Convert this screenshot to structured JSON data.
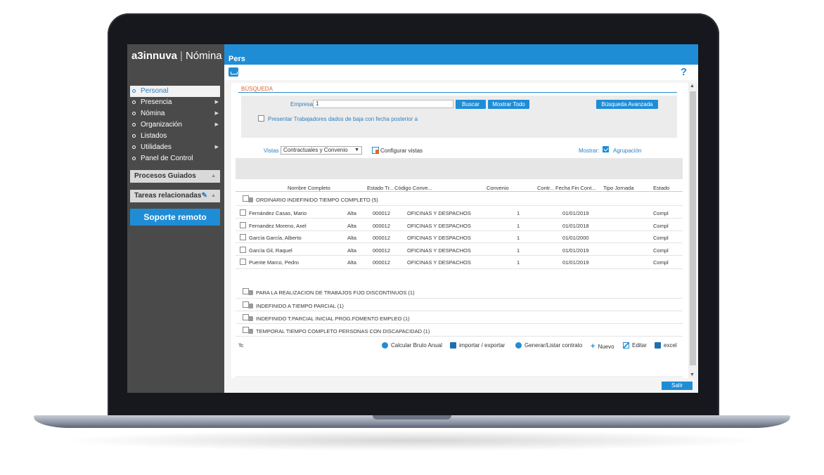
{
  "app": {
    "brand_bold": "a3innuva",
    "brand_separator": "|",
    "brand_product": "Nómina",
    "window_title": "Pers"
  },
  "sidebar": {
    "items": [
      {
        "label": "Personal",
        "active": true,
        "has_submenu": false
      },
      {
        "label": "Presencia",
        "has_submenu": true
      },
      {
        "label": "Nómina",
        "has_submenu": true
      },
      {
        "label": "Organización",
        "has_submenu": true
      },
      {
        "label": "Listados",
        "has_submenu": false
      },
      {
        "label": "Utilidades",
        "has_submenu": true
      },
      {
        "label": "Panel de Control",
        "has_submenu": false
      }
    ],
    "procesos_label": "Procesos Guiados",
    "tareas_label": "Tareas relacionadas",
    "remote_button": "Soporte remoto"
  },
  "search": {
    "section_label": "BÚSQUEDA",
    "empresa_label": "Empresa",
    "empresa_value": "1",
    "buscar_button": "Buscar",
    "mostrar_todo_button": "Mostrar Todo",
    "advanced_button": "Búsqueda Avanzada",
    "baja_checkbox_label": "Presentar Trabajadores dados de baja con fecha posterior a"
  },
  "views": {
    "label": "Vistas",
    "selected": "Contractuales y Convenio",
    "configure": "Configurar vistas",
    "mostrar_label": "Mostrar:",
    "agrupacion_label": "Agrupación"
  },
  "table": {
    "headers": [
      "Nombre Completo",
      "Estado Tr...",
      "Código Conve...",
      "Convenio",
      "Contr...",
      "Fecha Fin Cont...",
      "Tipo Jornada",
      "Estado"
    ],
    "expanded_group": "ORDINARIO INDEFINIDO TIEMPO COMPLETO (5)",
    "rows": [
      [
        "Fernández Casas, Mario",
        "Alta",
        "000012",
        "OFICINAS Y DESPACHOS",
        "1",
        "01/01/2019",
        "Compl"
      ],
      [
        "Fernandez Moreno, Axel",
        "Alta",
        "000012",
        "OFICINAS Y DESPACHOS",
        "1",
        "01/01/2018",
        "Compl"
      ],
      [
        "García García, Alberto",
        "Alta",
        "000012",
        "OFICINAS Y DESPACHOS",
        "1",
        "01/01/2000",
        "Compl"
      ],
      [
        "García Gil, Raquel",
        "Alta",
        "000012",
        "OFICINAS Y DESPACHOS",
        "1",
        "01/01/2019",
        "Compl"
      ],
      [
        "Puente Marco, Pedro",
        "Alta",
        "000012",
        "OFICINAS Y DESPACHOS",
        "1",
        "01/01/2019",
        "Compl"
      ]
    ],
    "collapsed_groups": [
      "PARA LA REALIZACION DE TRABAJOS FIJO DISCONTINUOS (1)",
      "INDEFINIDO A TIEMPO PARCIAL (1)",
      "INDEFINIDO T.PARCIAL INICIAL PROG.FOMENTO EMPLEO (1)",
      "TEMPORAL TIEMPO COMPLETO PERSONAS CON DISCAPACIDAD (1)"
    ],
    "footer_truncated": "Tc"
  },
  "actions": {
    "calcular": "Calcular Bruto Anual",
    "importar": "importar / exportar",
    "generar": "Generar/Listar contrato",
    "nuevo": "Nuevo",
    "editar": "Editar",
    "excel": "excel"
  },
  "salir_button": "Salir",
  "colors": {
    "accent": "#1f8dd6",
    "sidebar_bg": "#4a4a4a",
    "section_label": "#e0672a"
  },
  "icons": [
    "inbox-icon",
    "help-icon",
    "wrench-icon",
    "gear-icon",
    "excel-icon",
    "plus-icon",
    "pencil-icon",
    "config-views-icon",
    "checkbox-icon"
  ]
}
